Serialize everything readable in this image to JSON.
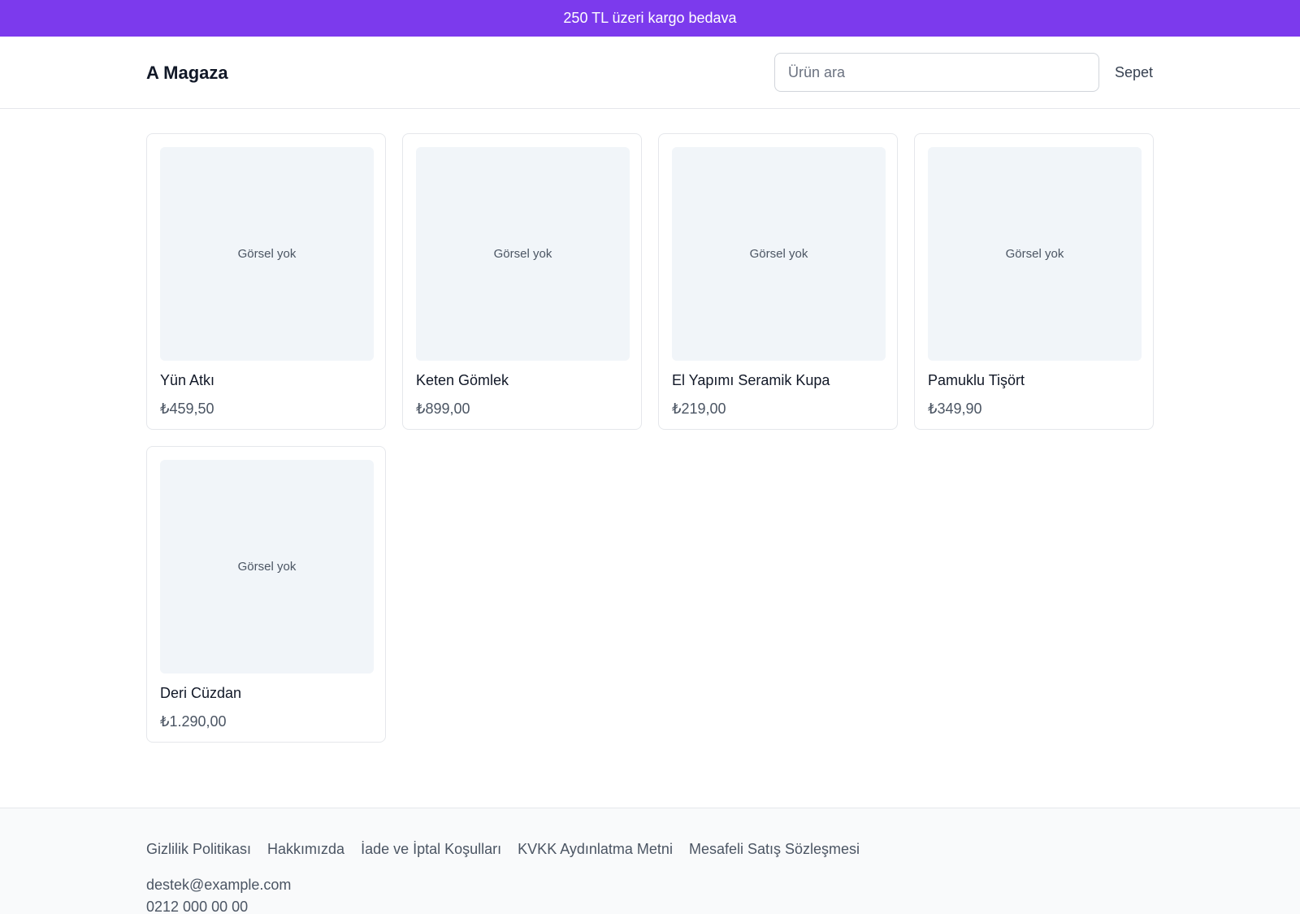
{
  "announcement": {
    "text": "250 TL üzeri kargo bedava"
  },
  "header": {
    "brand": "A Magaza",
    "search_placeholder": "Ürün ara",
    "cart_label": "Sepet"
  },
  "products": [
    {
      "name": "Yün Atkı",
      "price": "₺459,50",
      "image_placeholder": "Görsel yok"
    },
    {
      "name": "Keten Gömlek",
      "price": "₺899,00",
      "image_placeholder": "Görsel yok"
    },
    {
      "name": "El Yapımı Seramik Kupa",
      "price": "₺219,00",
      "image_placeholder": "Görsel yok"
    },
    {
      "name": "Pamuklu Tişört",
      "price": "₺349,90",
      "image_placeholder": "Görsel yok"
    },
    {
      "name": "Deri Cüzdan",
      "price": "₺1.290,00",
      "image_placeholder": "Görsel yok"
    }
  ],
  "footer": {
    "links": [
      "Gizlilik Politikası",
      "Hakkımızda",
      "İade ve İptal Koşulları",
      "KVKK Aydınlatma Metni",
      "Mesafeli Satış Sözleşmesi"
    ],
    "email": "destek@example.com",
    "phone": "0212 000 00 00"
  },
  "colors": {
    "announcement_bg": "#7c3aed",
    "image_placeholder_bg": "#f1f5f9",
    "footer_bg": "#f9fafb"
  }
}
